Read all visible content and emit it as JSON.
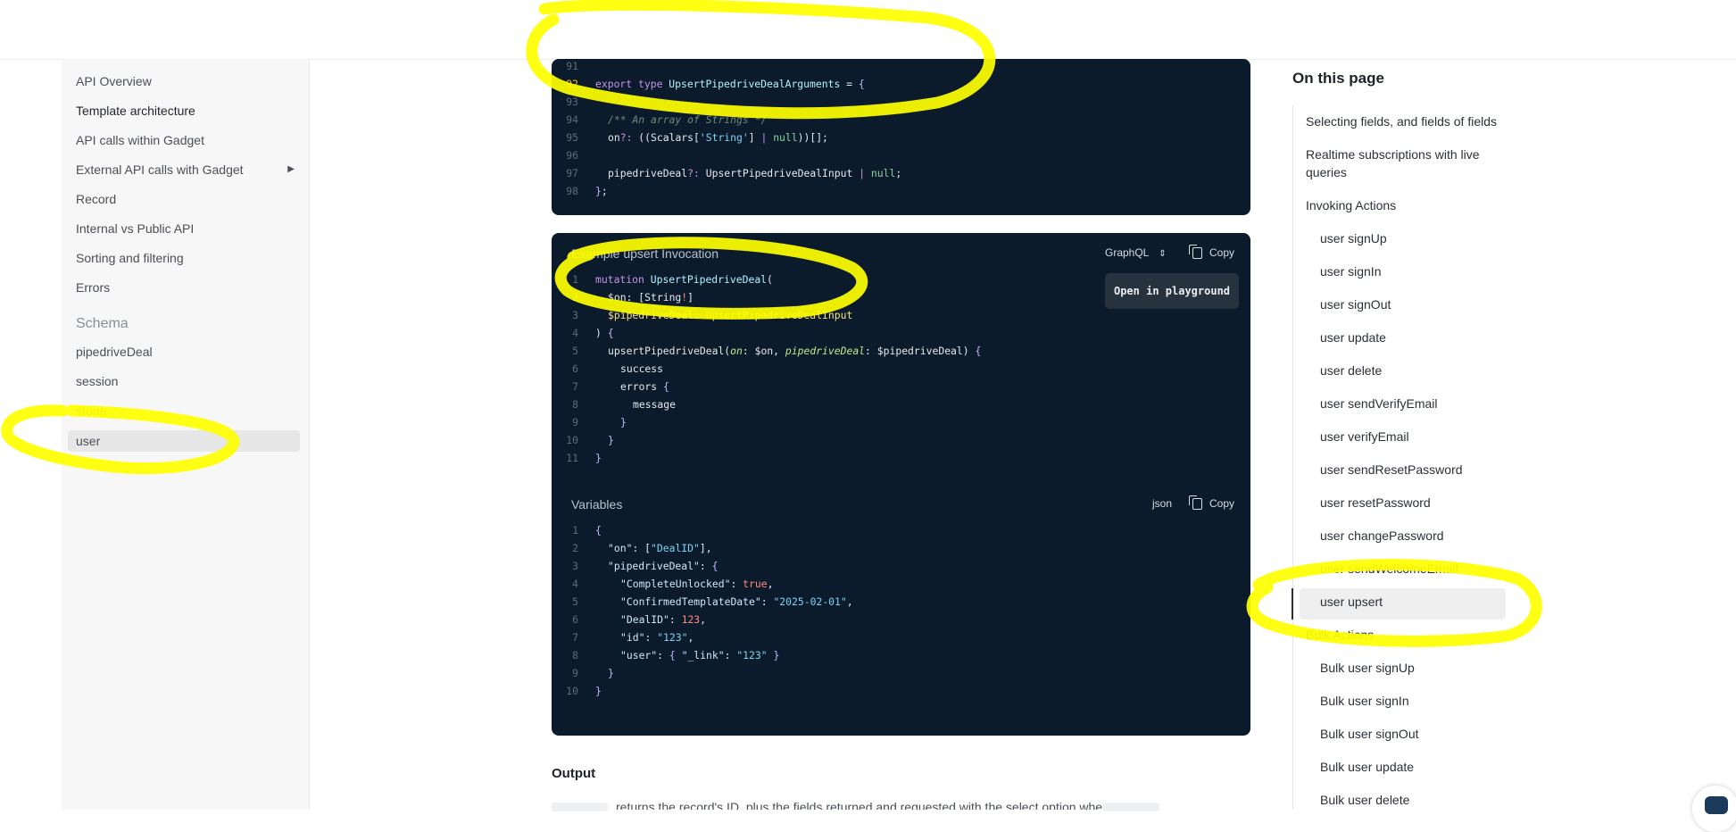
{
  "sidebar": {
    "items": [
      {
        "label": "API Overview"
      },
      {
        "label": "Template architecture"
      },
      {
        "label": "API calls within Gadget"
      },
      {
        "label": "External API calls with Gadget"
      },
      {
        "label": "Record"
      },
      {
        "label": "Internal vs Public API"
      },
      {
        "label": "Sorting and filtering"
      },
      {
        "label": "Errors"
      }
    ],
    "schema_heading": "Schema",
    "schema_items": [
      {
        "label": "pipedriveDeal"
      },
      {
        "label": "session"
      },
      {
        "label": "stone"
      },
      {
        "label": "user"
      }
    ]
  },
  "type_block": {
    "line_numbers": [
      "91",
      "92",
      "93",
      "94",
      "95",
      "96",
      "97",
      "98"
    ],
    "comment": "/** An array of Strings */"
  },
  "invocation": {
    "title": "Example upsert Invocation",
    "language": "GraphQL",
    "copy_label": "Copy",
    "playground_label": "Open in playground",
    "line_numbers": [
      "1",
      "2",
      "3",
      "4",
      "5",
      "6",
      "7",
      "8",
      "9",
      "10",
      "11"
    ]
  },
  "variables": {
    "title": "Variables",
    "language": "json",
    "copy_label": "Copy",
    "line_numbers": [
      "1",
      "2",
      "3",
      "4",
      "5",
      "6",
      "7",
      "8",
      "9",
      "10"
    ]
  },
  "output": {
    "heading": "Output",
    "text": "returns the record's ID, plus the fields returned and requested with the select option when"
  },
  "toc": {
    "title": "On this page",
    "items": [
      {
        "label": "Selecting fields, and fields of fields"
      },
      {
        "label": "Realtime subscriptions with live queries"
      },
      {
        "label": "Invoking Actions"
      },
      {
        "label": "user signUp"
      },
      {
        "label": "user signIn"
      },
      {
        "label": "user signOut"
      },
      {
        "label": "user update"
      },
      {
        "label": "user delete"
      },
      {
        "label": "user sendVerifyEmail"
      },
      {
        "label": "user verifyEmail"
      },
      {
        "label": "user sendResetPassword"
      },
      {
        "label": "user resetPassword"
      },
      {
        "label": "user changePassword"
      },
      {
        "label": "user sendWelcomeEmail"
      },
      {
        "label": "user upsert"
      },
      {
        "label": "Bulk Actions"
      },
      {
        "label": "Bulk user signUp"
      },
      {
        "label": "Bulk user signIn"
      },
      {
        "label": "Bulk user signOut"
      },
      {
        "label": "Bulk user update"
      },
      {
        "label": "Bulk user delete"
      }
    ]
  },
  "colors": {
    "code_bg": "#0b1b2b",
    "highlight": "#ffff00",
    "sidebar_bg": "#f7f7f8"
  }
}
